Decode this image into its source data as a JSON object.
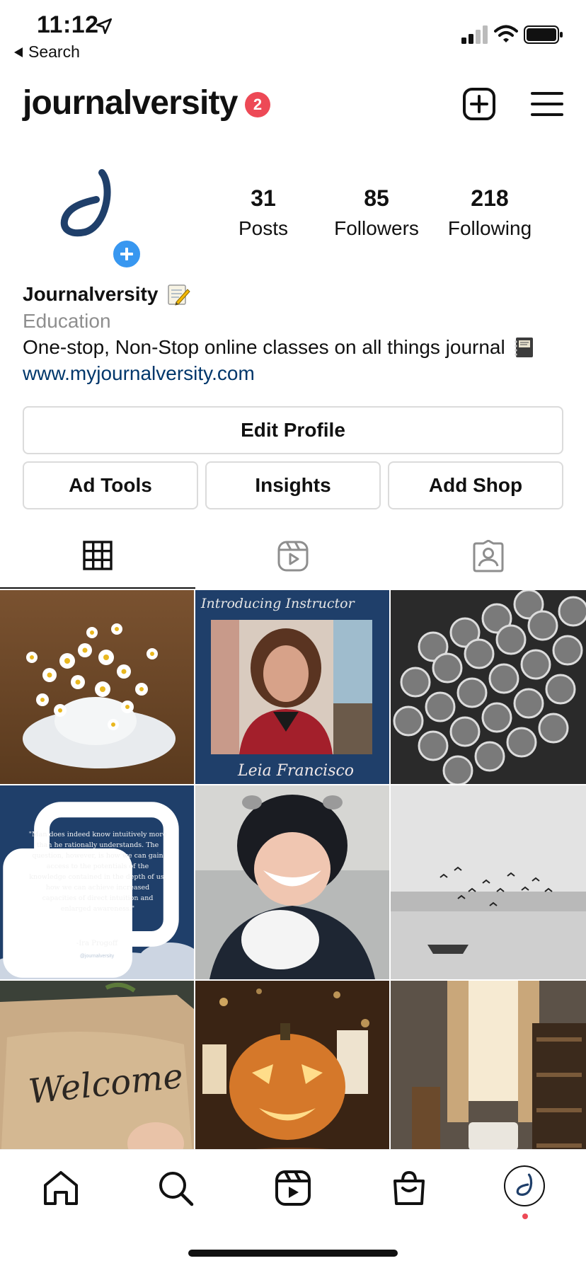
{
  "status_bar": {
    "time": "11:12",
    "back_label": "Search"
  },
  "header": {
    "username": "journalversity",
    "notification_count": "2"
  },
  "profile": {
    "stats": [
      {
        "value": "31",
        "label": "Posts"
      },
      {
        "value": "85",
        "label": "Followers"
      },
      {
        "value": "218",
        "label": "Following"
      }
    ],
    "display_name": "Journalversity",
    "category": "Education",
    "bio": "One-stop, Non-Stop online classes on all things journal",
    "website": "www.myjournalversity.com"
  },
  "buttons": {
    "edit_profile": "Edit Profile",
    "ad_tools": "Ad Tools",
    "insights": "Insights",
    "add_shop": "Add Shop"
  },
  "tabs": [
    "grid-icon",
    "reels-icon",
    "tagged-icon"
  ],
  "posts": {
    "intro_title": "Introducing Instructor",
    "intro_name": "Leia Francisco",
    "quote": "\"Man does indeed know intuitively more than he rationally understands. The question, however, is how we can gain access to the potentials of the knowledge contained in the depth of us, how we can achieve increased capacities of direct intuition and enlarged awareness.\"",
    "quote_author": "-Ira Progoff",
    "quote_handle": "@journalversity",
    "welcome": "Welcome"
  },
  "bottom_nav": [
    "home-icon",
    "search-icon",
    "reels-icon",
    "shop-icon",
    "profile-avatar"
  ],
  "colors": {
    "accent_blue": "#3897f0",
    "badge_red": "#ed4956",
    "link_blue": "#00376b",
    "brand_navy": "#1f3f6a"
  }
}
